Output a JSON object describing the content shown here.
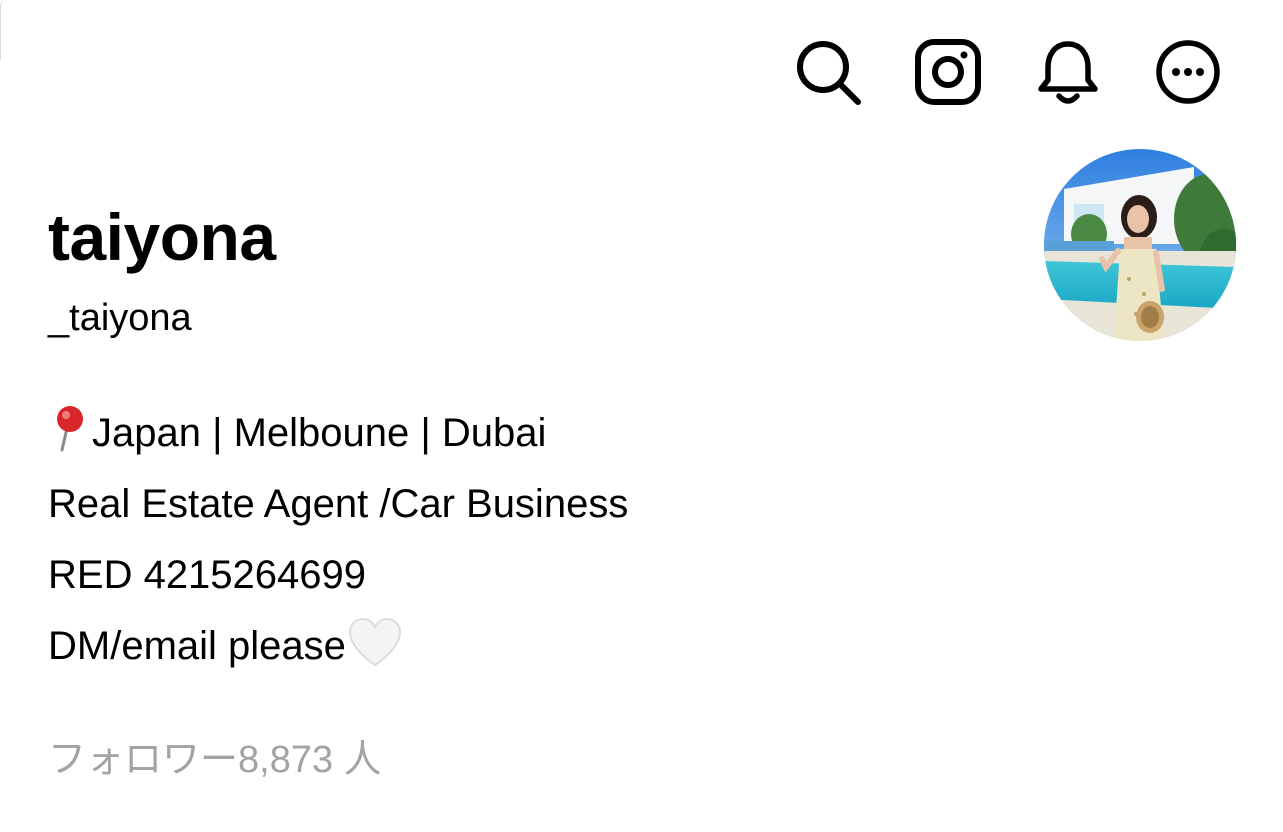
{
  "header": {
    "icons": [
      {
        "name": "search-icon"
      },
      {
        "name": "instagram-icon"
      },
      {
        "name": "bell-icon"
      },
      {
        "name": "more-icon"
      }
    ]
  },
  "profile": {
    "display_name": "taiyona",
    "username": "_taiyona",
    "bio": {
      "location": "Japan | Melboune | Dubai",
      "occupation": "Real Estate Agent /Car Business",
      "red_id": "RED 4215264699",
      "contact": "DM/email please"
    },
    "followers_label": "フォロワー8,873 人"
  },
  "colors": {
    "text": "#000000",
    "muted": "#a3a3a3",
    "pin": "#d9262b"
  }
}
